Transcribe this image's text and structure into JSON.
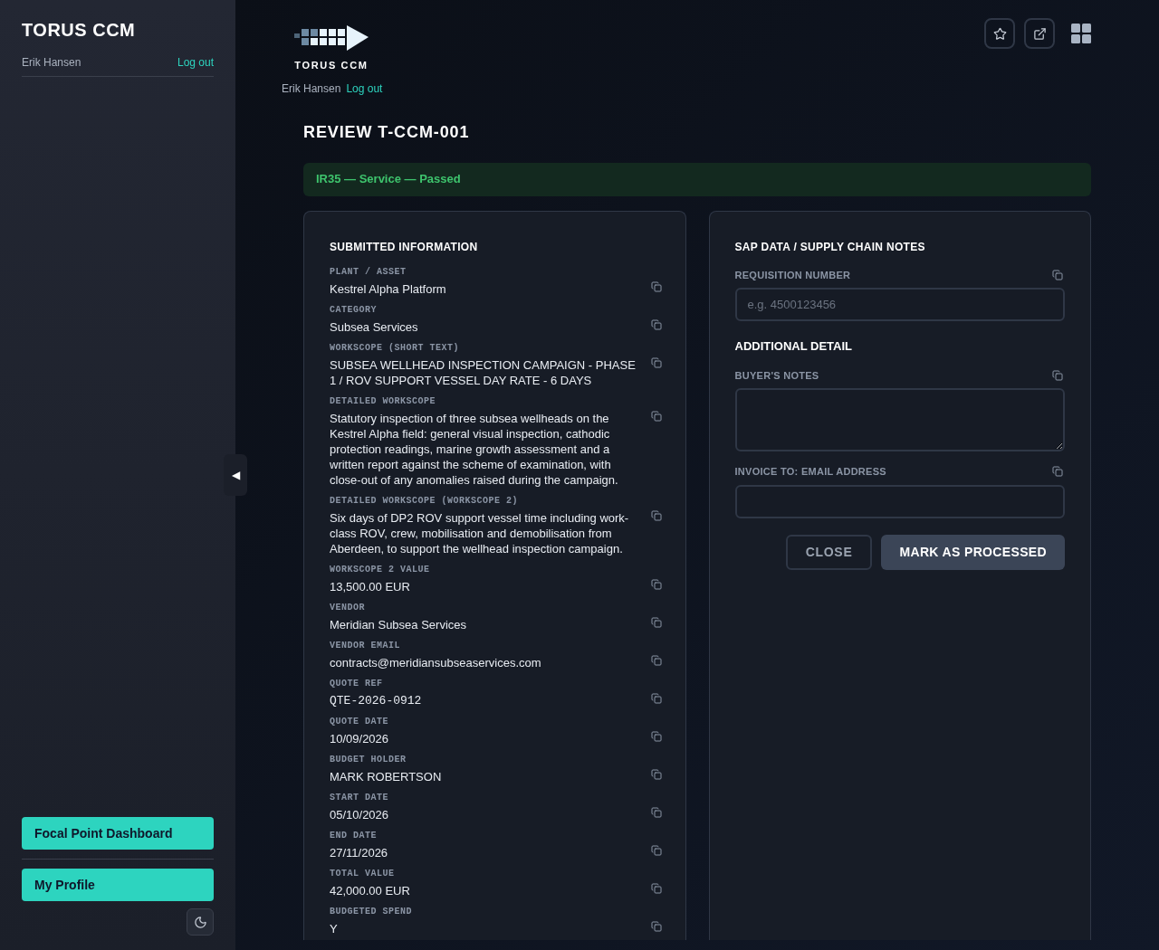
{
  "sidebar": {
    "title": "TORUS CCM",
    "user": "Erik Hansen",
    "logout": "Log out",
    "nav": [
      {
        "label": "Focal Point Dashboard"
      },
      {
        "label": "My Profile"
      }
    ],
    "collapse_glyph": "◀"
  },
  "header": {
    "logo_text": "TORUS CCM",
    "user": "Erik Hansen",
    "logout": "Log out"
  },
  "page_title": "REVIEW T-CCM-001",
  "status_banner": "IR35 — Service — Passed",
  "submitted": {
    "heading": "SUBMITTED INFORMATION",
    "fields": [
      {
        "label": "PLANT / ASSET",
        "value": "Kestrel Alpha Platform",
        "kind": "text"
      },
      {
        "label": "CATEGORY",
        "value": "Subsea Services",
        "kind": "text"
      },
      {
        "label": "WORKSCOPE (SHORT TEXT)",
        "value": "SUBSEA WELLHEAD INSPECTION CAMPAIGN - PHASE 1 / ROV SUPPORT VESSEL DAY RATE - 6 DAYS",
        "kind": "text"
      },
      {
        "label": "DETAILED WORKSCOPE",
        "value": "Statutory inspection of three subsea wellheads on the Kestrel Alpha field: general visual inspection, cathodic protection readings, marine growth assessment and a written report against the scheme of examination, with close-out of any anomalies raised during the campaign.",
        "kind": "text"
      },
      {
        "label": "DETAILED WORKSCOPE (WORKSCOPE 2)",
        "value": "Six days of DP2 ROV support vessel time including work-class ROV, crew, mobilisation and demobilisation from Aberdeen, to support the wellhead inspection campaign.",
        "kind": "text"
      },
      {
        "label": "WORKSCOPE 2 VALUE",
        "value": "13,500.00 EUR",
        "kind": "text"
      },
      {
        "label": "VENDOR",
        "value": "Meridian Subsea Services",
        "kind": "text"
      },
      {
        "label": "VENDOR EMAIL",
        "value": "contracts@meridiansubseaservices.com",
        "kind": "text"
      },
      {
        "label": "QUOTE REF",
        "value": "QTE-2026-0912",
        "kind": "mono"
      },
      {
        "label": "QUOTE DATE",
        "value": "10/09/2026",
        "kind": "text"
      },
      {
        "label": "BUDGET HOLDER",
        "value": "MARK ROBERTSON",
        "kind": "text"
      },
      {
        "label": "START DATE",
        "value": "05/10/2026",
        "kind": "text"
      },
      {
        "label": "END DATE",
        "value": "27/11/2026",
        "kind": "text"
      },
      {
        "label": "TOTAL VALUE",
        "value": "42,000.00 EUR",
        "kind": "text"
      },
      {
        "label": "BUDGETED SPEND",
        "value": "Y",
        "kind": "text"
      }
    ]
  },
  "sap": {
    "heading": "SAP DATA / SUPPLY CHAIN NOTES",
    "fields": [
      {
        "label": "REQUISITION NUMBER",
        "placeholder": "e.g. 4500123456",
        "kind": "input"
      },
      {
        "heading": "ADDITIONAL DETAIL",
        "kind": "heading"
      },
      {
        "label": "BUYER'S NOTES",
        "kind": "textarea"
      },
      {
        "label": "INVOICE TO: EMAIL ADDRESS",
        "kind": "input"
      }
    ],
    "buttons": [
      {
        "label": "CLOSE",
        "kind": "secondary"
      },
      {
        "label": "MARK AS PROCESSED",
        "kind": "primary"
      }
    ]
  }
}
